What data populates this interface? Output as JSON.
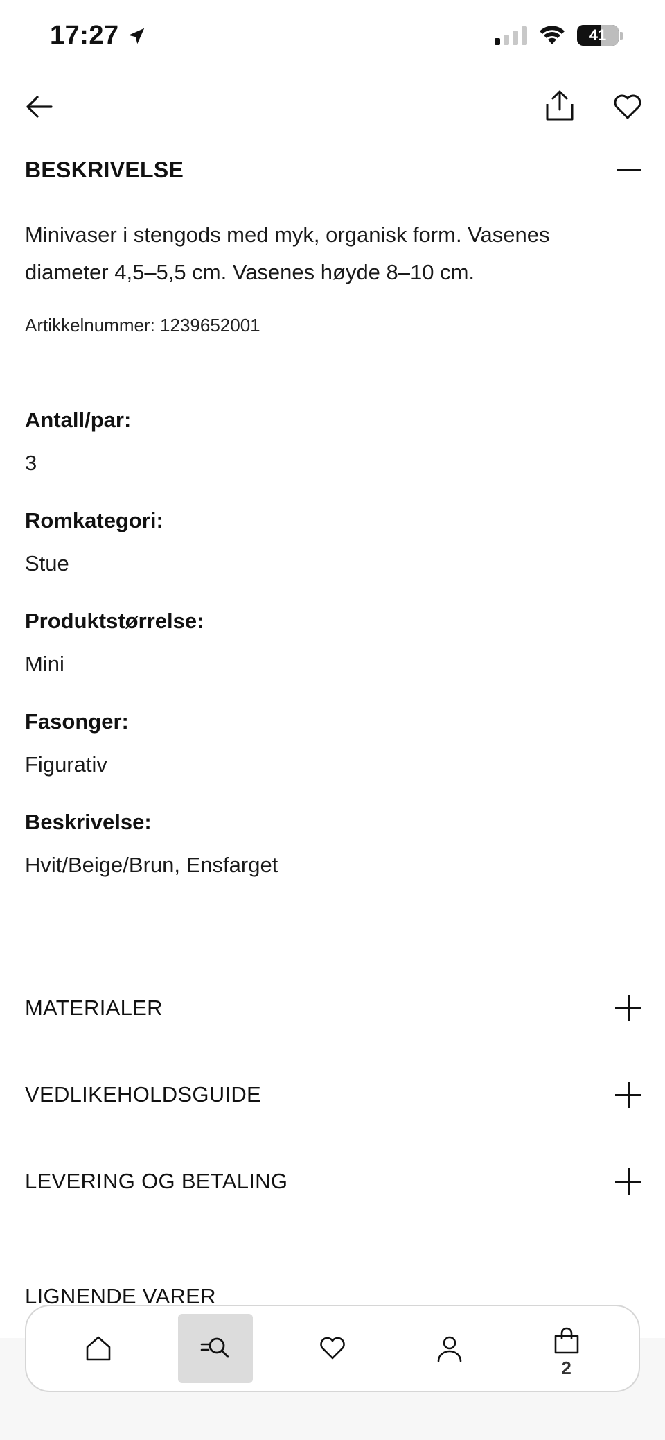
{
  "status_bar": {
    "time": "17:27",
    "battery": "41",
    "location_icon": "location-arrow-icon",
    "signal_icon": "cellular-signal-icon",
    "wifi_icon": "wifi-icon"
  },
  "nav": {
    "back_icon": "arrow-left-icon",
    "share_icon": "share-icon",
    "favorite_icon": "heart-icon"
  },
  "description_section": {
    "title": "BESKRIVELSE",
    "text": "Minivaser i stengods med myk, organisk form. Vasenes diameter 4,5–5,5 cm. Vasenes høyde 8–10 cm.",
    "article_number": "Artikkelnummer: 1239652001",
    "attributes": [
      {
        "label": "Antall/par:",
        "value": "3"
      },
      {
        "label": "Romkategori:",
        "value": "Stue"
      },
      {
        "label": "Produktstørrelse:",
        "value": "Mini"
      },
      {
        "label": "Fasonger:",
        "value": "Figurativ"
      },
      {
        "label": "Beskrivelse:",
        "value": "Hvit/Beige/Brun, Ensfarget"
      }
    ]
  },
  "accordions": [
    {
      "label": "MATERIALER"
    },
    {
      "label": "VEDLIKEHOLDSGUIDE"
    },
    {
      "label": "LEVERING OG BETALING"
    }
  ],
  "similar_title": "LIGNENDE VARER",
  "tab_bar": {
    "tabs": [
      {
        "name": "home",
        "icon": "home-icon"
      },
      {
        "name": "search",
        "icon": "search-icon",
        "active": true
      },
      {
        "name": "favorites",
        "icon": "heart-icon"
      },
      {
        "name": "account",
        "icon": "user-icon"
      },
      {
        "name": "cart",
        "icon": "shopping-bag-icon"
      }
    ],
    "cart_count": "2"
  },
  "colors": {
    "text": "#111111",
    "active_tab_bg": "#dcdcdc",
    "tab_border": "#d6d6d6"
  }
}
